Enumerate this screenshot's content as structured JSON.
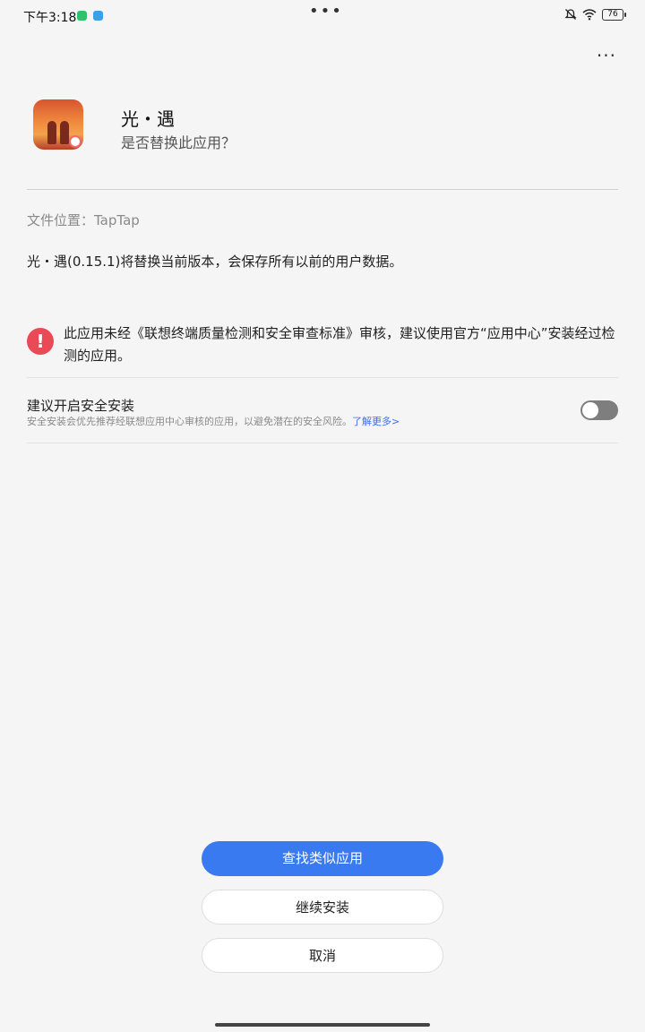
{
  "status_bar": {
    "time": "下午3:18",
    "battery": "76",
    "app_icons": [
      {
        "name": "wechat-icon",
        "color": "#2dc36a"
      },
      {
        "name": "message-icon",
        "color": "#3aa0e8"
      }
    ]
  },
  "app": {
    "name": "光・遇",
    "question": "是否替换此应用？"
  },
  "file_location": "文件位置：TapTap",
  "replace_message": "光・遇(0.15.1)将替换当前版本，会保存所有以前的用户数据。",
  "warning": {
    "icon_char": "!",
    "text": "此应用未经《联想终端质量检测和安全审查标准》审核，建议使用官方“应用中心”安装经过检测的应用。"
  },
  "safe_install": {
    "title": "建议开启安全安装",
    "description": "安全安装会优先推荐经联想应用中心审核的应用，以避免潜在的安全风险。",
    "link": "了解更多>",
    "enabled": false
  },
  "buttons": {
    "find_similar": "查找类似应用",
    "continue_install": "继续安装",
    "cancel": "取消"
  },
  "colors": {
    "primary": "#3a7af0",
    "warning": "#ea4a56",
    "link": "#3a6fe6"
  }
}
